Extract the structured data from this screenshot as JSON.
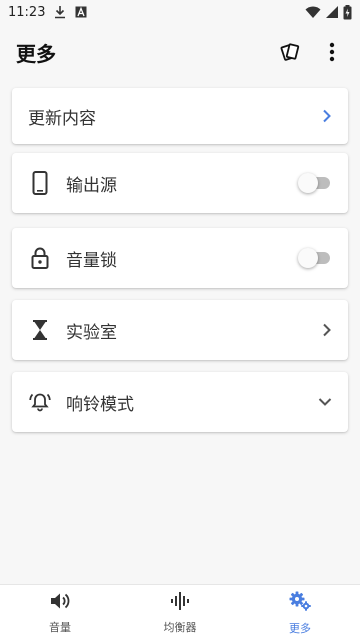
{
  "status_bar": {
    "time": "11:23",
    "icons": [
      "download-icon",
      "a-notification-icon",
      "wifi-icon",
      "signal-icon",
      "battery-charging-icon"
    ]
  },
  "app_bar": {
    "title": "更多",
    "actions": [
      "cards-icon",
      "more-vert-icon"
    ]
  },
  "update_card": {
    "label": "更新内容",
    "icon": "chevron-right-icon"
  },
  "settings": [
    {
      "label": "输出源",
      "icon": "phone-icon",
      "control": "toggle",
      "on": false
    },
    {
      "label": "音量锁",
      "icon": "lock-icon",
      "control": "toggle",
      "on": false
    },
    {
      "label": "实验室",
      "icon": "hourglass-icon",
      "control": "chevron-right"
    },
    {
      "label": "响铃模式",
      "icon": "alarm-bell-icon",
      "control": "chevron-down"
    }
  ],
  "bottom_nav": {
    "items": [
      {
        "label": "音量",
        "icon": "volume-icon",
        "active": false
      },
      {
        "label": "均衡器",
        "icon": "equalizer-icon",
        "active": false
      },
      {
        "label": "更多",
        "icon": "gears-icon",
        "active": true
      }
    ]
  },
  "colors": {
    "accent": "#4a7ee0",
    "background": "#f7f7f7",
    "card": "#ffffff",
    "icon": "#333333"
  }
}
